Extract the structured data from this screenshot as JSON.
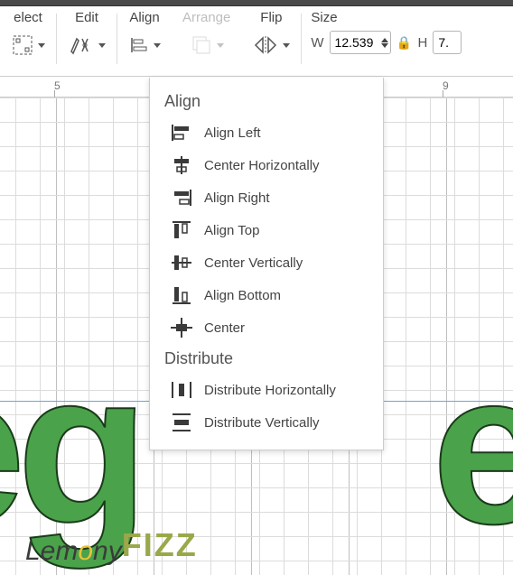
{
  "toolbar": {
    "select": "elect",
    "edit": "Edit",
    "align": "Align",
    "arrange": "Arrange",
    "flip": "Flip",
    "size": "Size",
    "w_label": "W",
    "w_value": "12.539",
    "h_label": "H",
    "h_value": "7."
  },
  "ruler": {
    "ticks": [
      {
        "pos": 60,
        "label": "5"
      },
      {
        "pos": 490,
        "label": "9"
      }
    ]
  },
  "dropdown": {
    "section1": "Align",
    "items1": [
      {
        "key": "align-left",
        "label": "Align Left"
      },
      {
        "key": "center-horizontally",
        "label": "Center Horizontally"
      },
      {
        "key": "align-right",
        "label": "Align Right"
      },
      {
        "key": "align-top",
        "label": "Align Top"
      },
      {
        "key": "center-vertically",
        "label": "Center Vertically"
      },
      {
        "key": "align-bottom",
        "label": "Align Bottom"
      },
      {
        "key": "center",
        "label": "Center"
      }
    ],
    "section2": "Distribute",
    "items2": [
      {
        "key": "distribute-horizontally",
        "label": "Distribute Horizontally"
      },
      {
        "key": "distribute-vertically",
        "label": "Distribute Vertically"
      }
    ]
  },
  "canvas_text": {
    "left": "eg",
    "right": "er"
  },
  "watermark": {
    "part1": "Lem",
    "o": "o",
    "part2": "ny",
    "fizz": "FIZZ"
  }
}
